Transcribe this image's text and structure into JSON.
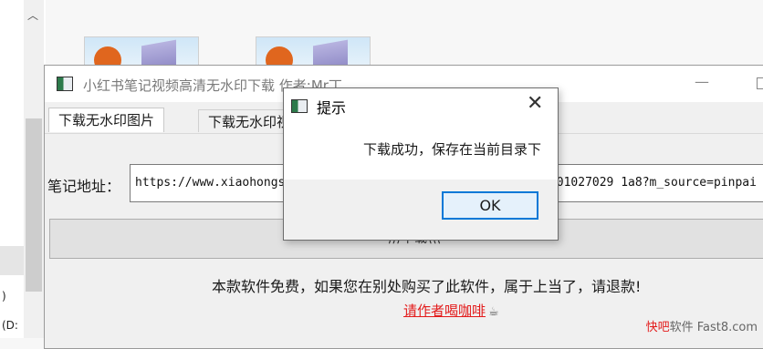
{
  "explorer": {
    "left_text_1": ")",
    "left_text_2": "(D:"
  },
  "app": {
    "title": "小红书笔记视频高清无水印下载 作者:Mr丁",
    "tabs": [
      {
        "label": "下载无水印图片"
      },
      {
        "label": "下载无水印视频"
      }
    ],
    "url_label": "笔记地址：",
    "url_value": "https://www.xiaohongshu.com/discovery/item/5e84b3c50000000001027029 1a8?m_source=pinpai",
    "download_label": "///下载\\\\\\",
    "notice": "本款软件免费，如果您在别处购买了此软件，属于上当了，请退款!",
    "coffee_link": "请作者喝咖啡"
  },
  "dialog": {
    "title": "提示",
    "message": "下载成功，保存在当前目录下",
    "ok_label": "OK"
  },
  "watermark": {
    "part1": "快吧",
    "part2": "软件 Fast8.com"
  },
  "colors": {
    "link": "#e31b1b",
    "focus": "#0078d7"
  }
}
